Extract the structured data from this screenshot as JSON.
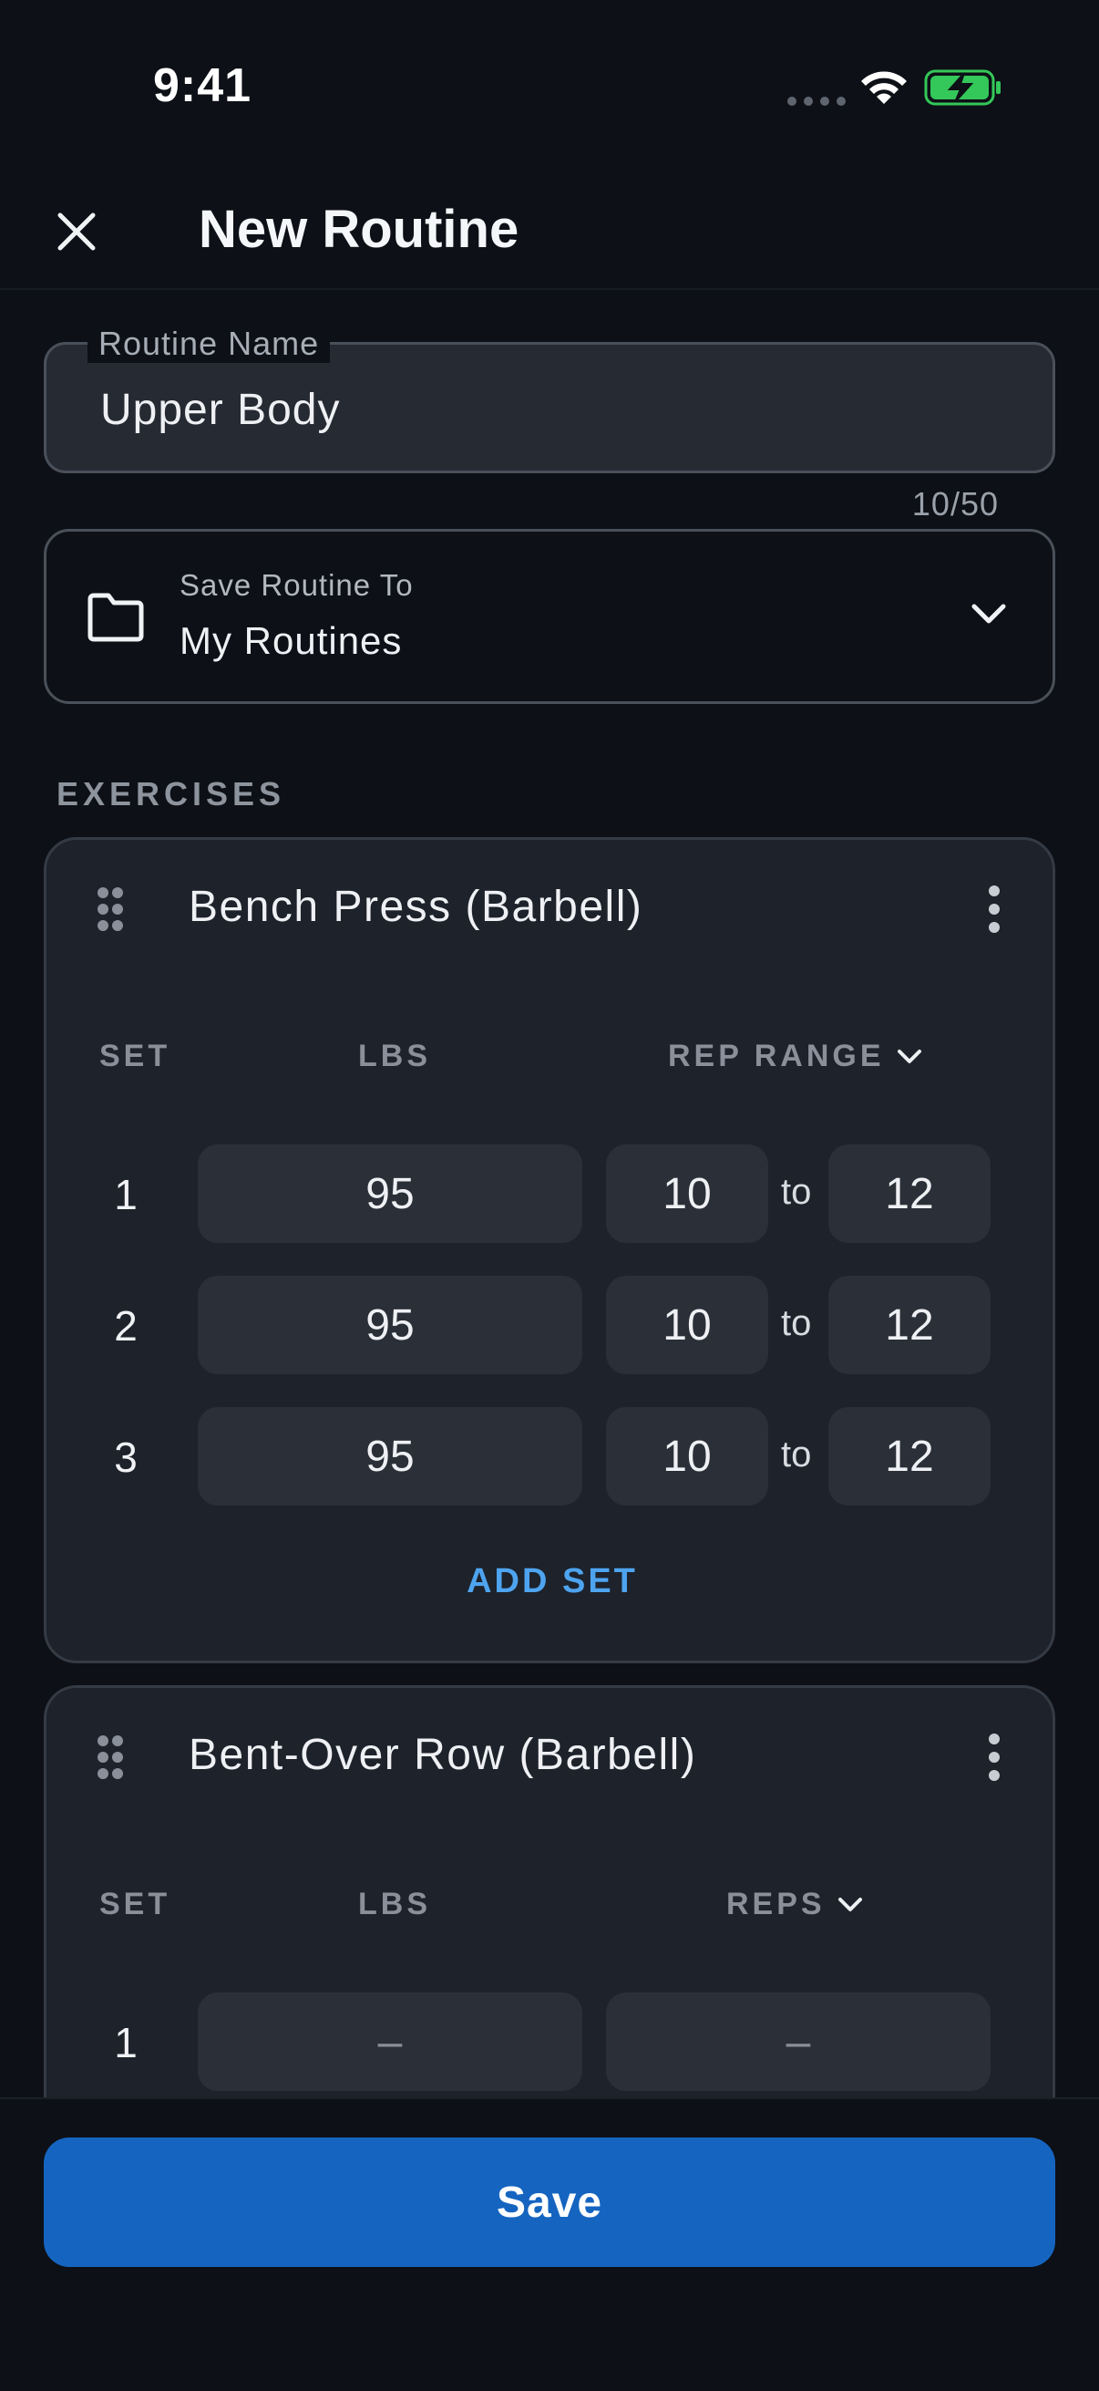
{
  "status_bar": {
    "time": "9:41",
    "icons": [
      "cellular-signal-icon",
      "wifi-icon",
      "battery-charging-icon"
    ]
  },
  "header": {
    "title": "New Routine",
    "close_icon": "close-icon"
  },
  "routine_name": {
    "label": "Routine Name",
    "value": "Upper Body",
    "counter": "10/50"
  },
  "save_to": {
    "label": "Save Routine To",
    "value": "My Routines",
    "icon": "folder-icon"
  },
  "exercises_section": {
    "label": "EXERCISES"
  },
  "exercises": [
    {
      "name": "Bench Press (Barbell)",
      "columns": {
        "set": "SET",
        "weight": "LBS",
        "reps": "REP RANGE"
      },
      "sets": [
        {
          "set": "1",
          "lbs": "95",
          "rep_min": "10",
          "to": "to",
          "rep_max": "12"
        },
        {
          "set": "2",
          "lbs": "95",
          "rep_min": "10",
          "to": "to",
          "rep_max": "12"
        },
        {
          "set": "3",
          "lbs": "95",
          "rep_min": "10",
          "to": "to",
          "rep_max": "12"
        }
      ],
      "add_set": "ADD SET"
    },
    {
      "name": "Bent-Over Row (Barbell)",
      "columns": {
        "set": "SET",
        "weight": "LBS",
        "reps": "REPS"
      },
      "sets": [
        {
          "set": "1",
          "lbs": "–",
          "reps": "–"
        }
      ]
    }
  ],
  "footer": {
    "save_label": "Save"
  },
  "colors": {
    "background": "#0d1016",
    "card": "#1d222b",
    "input": "#2a2f38",
    "accent_blue": "#1565c0",
    "link_blue": "#4ea4ef",
    "battery_green": "#34c759"
  }
}
